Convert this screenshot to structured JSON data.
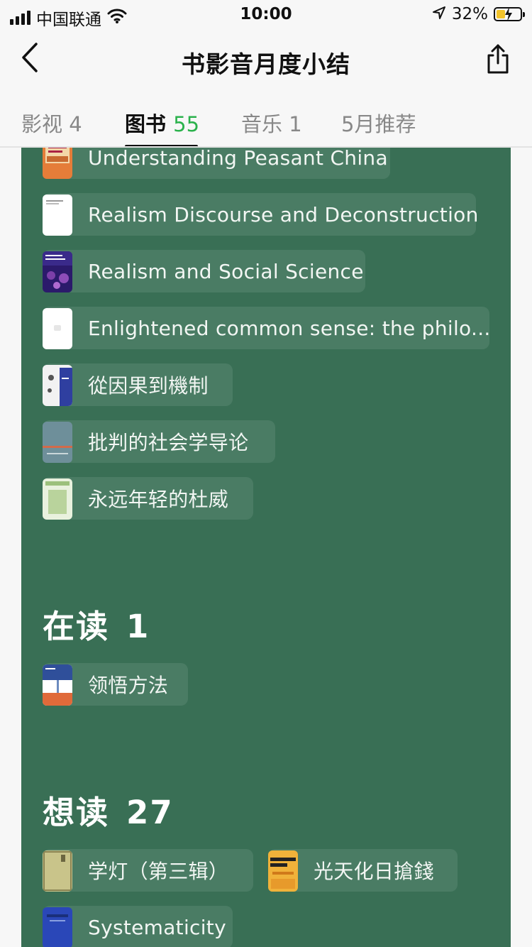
{
  "status_bar": {
    "carrier": "中国联通",
    "time": "10:00",
    "battery": "32%"
  },
  "nav": {
    "title": "书影音月度小结"
  },
  "tabs": [
    {
      "label": "影视",
      "count": "4"
    },
    {
      "label": "图书",
      "count": "55"
    },
    {
      "label": "音乐",
      "count": "1"
    },
    {
      "label": "5月推荐",
      "count": ""
    }
  ],
  "read_books": [
    {
      "title": "Understanding Peasant China"
    },
    {
      "title": "Realism Discourse and Deconstruction"
    },
    {
      "title": "Realism and Social Science"
    },
    {
      "title": "Enlightened common sense: the philo..."
    },
    {
      "title": "從因果到機制"
    },
    {
      "title": "批判的社会学导论"
    },
    {
      "title": "永远年轻的杜威"
    }
  ],
  "reading": {
    "label": "在读",
    "count": "1",
    "books": [
      {
        "title": "领悟方法"
      }
    ]
  },
  "wish": {
    "label": "想读",
    "count": "27",
    "books": [
      {
        "title": "学灯（第三辑）"
      },
      {
        "title": "光天化日搶錢"
      },
      {
        "title": "Systematicity"
      }
    ]
  },
  "colors": {
    "card": "#396f55",
    "accent": "#2bb24c"
  },
  "icons": [
    "signal-icon",
    "wifi-icon",
    "location-icon",
    "battery-icon",
    "back-chevron-icon",
    "share-icon"
  ]
}
